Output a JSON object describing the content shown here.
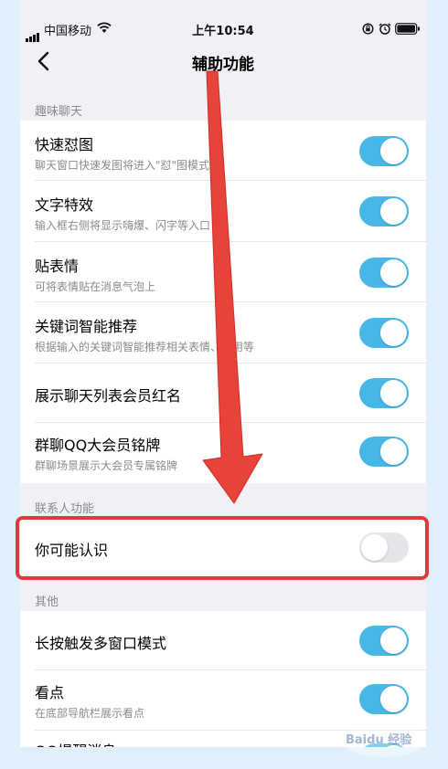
{
  "status": {
    "carrier": "中国移动",
    "time": "上午10:54"
  },
  "nav": {
    "title": "辅助功能"
  },
  "sections": {
    "fun_chat": "趣味聊天",
    "contacts": "联系人功能",
    "other": "其他"
  },
  "items": {
    "quick_reply": {
      "title": "快速怼图",
      "subtitle": "聊天窗口快速发图将进入\"怼\"图模式",
      "enabled": true
    },
    "text_effects": {
      "title": "文字特效",
      "subtitle": "输入框右侧将显示嗨爆、闪字等入口",
      "enabled": true
    },
    "stickers": {
      "title": "贴表情",
      "subtitle": "可将表情贴在消息气泡上",
      "enabled": true
    },
    "keyword": {
      "title": "关键词智能推荐",
      "subtitle": "根据输入的关键词智能推荐相关表情、应用等",
      "enabled": true
    },
    "vip_red": {
      "title": "展示聊天列表会员红名",
      "enabled": true
    },
    "group_badge": {
      "title": "群聊QQ大会员铭牌",
      "subtitle": "群聊场景展示大会员专属铭牌",
      "enabled": true
    },
    "may_know": {
      "title": "你可能认识",
      "enabled": false
    },
    "multiwindow": {
      "title": "长按触发多窗口模式",
      "enabled": true
    },
    "kandian": {
      "title": "看点",
      "subtitle": "在底部导航栏展示看点",
      "enabled": true
    },
    "qq_reminder": {
      "title": "QQ提醒消息"
    }
  },
  "colors": {
    "accent": "#47b8e6",
    "annotation": "#e03a3f"
  },
  "watermark": {
    "text": "Baidu 经验"
  }
}
